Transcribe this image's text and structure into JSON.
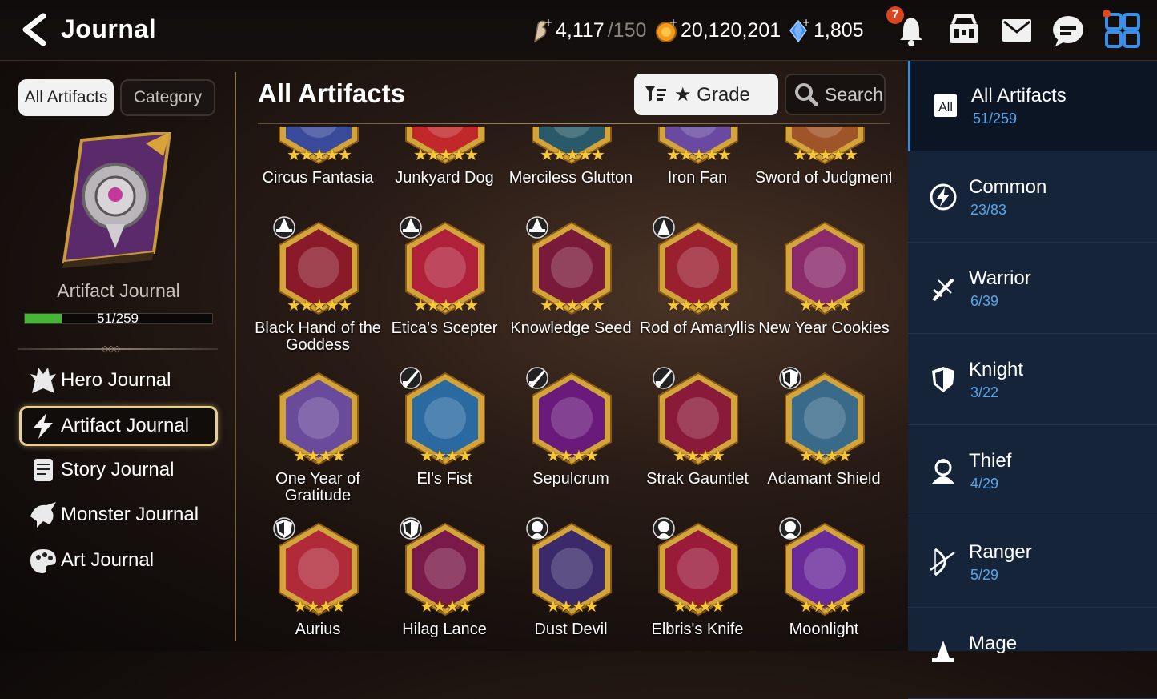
{
  "header": {
    "title": "Journal",
    "stamina_value": "4,117",
    "stamina_max": "/150",
    "gold": "20,120,201",
    "crystals": "1,805",
    "notification_count": "7"
  },
  "left": {
    "tab_all": "All Artifacts",
    "tab_category": "Category",
    "journal_label": "Artifact Journal",
    "progress_text": "51/259",
    "progress_fraction": 0.197,
    "nav": [
      {
        "label": "Hero Journal",
        "icon": "hero-icon"
      },
      {
        "label": "Artifact Journal",
        "icon": "lightning-icon"
      },
      {
        "label": "Story Journal",
        "icon": "scroll-icon"
      },
      {
        "label": "Monster Journal",
        "icon": "monster-icon"
      },
      {
        "label": "Art Journal",
        "icon": "palette-icon"
      }
    ]
  },
  "main": {
    "title": "All Artifacts",
    "grade_label": "★ Grade",
    "search_label": "Search",
    "artifacts": [
      {
        "name": "Circus Fantasia",
        "stars": 5,
        "color": "#3a4a9a",
        "cls": ""
      },
      {
        "name": "Junkyard Dog",
        "stars": 5,
        "color": "#c0282a",
        "cls": ""
      },
      {
        "name": "Merciless Glutton",
        "stars": 5,
        "color": "#2a5a6a",
        "cls": ""
      },
      {
        "name": "Iron Fan",
        "stars": 5,
        "color": "#6a4aa0",
        "cls": ""
      },
      {
        "name": "Sword of Judgment",
        "stars": 5,
        "color": "#a0542a",
        "cls": ""
      },
      {
        "name": "Black Hand of the Goddess",
        "stars": 5,
        "color": "#8a1a2a",
        "cls": "mage"
      },
      {
        "name": "Etica's Scepter",
        "stars": 5,
        "color": "#b0203a",
        "cls": "mage"
      },
      {
        "name": "Knowledge Seed",
        "stars": 5,
        "color": "#7a1a3a",
        "cls": "mage"
      },
      {
        "name": "Rod of Amaryllis",
        "stars": 5,
        "color": "#9a2030",
        "cls": "soul"
      },
      {
        "name": "New Year Cookies",
        "stars": 4,
        "color": "#8a2a6a",
        "cls": ""
      },
      {
        "name": "One Year of Gratitude",
        "stars": 4,
        "color": "#6a4a9a",
        "cls": ""
      },
      {
        "name": "El's Fist",
        "stars": 4,
        "color": "#2a6aa0",
        "cls": "warrior"
      },
      {
        "name": "Sepulcrum",
        "stars": 4,
        "color": "#6a1a7a",
        "cls": "warrior"
      },
      {
        "name": "Strak Gauntlet",
        "stars": 4,
        "color": "#8a1a3a",
        "cls": "warrior"
      },
      {
        "name": "Adamant Shield",
        "stars": 4,
        "color": "#3a6a8a",
        "cls": "knight"
      },
      {
        "name": "Aurius",
        "stars": 4,
        "color": "#b02a3a",
        "cls": "knight"
      },
      {
        "name": "Hilag Lance",
        "stars": 4,
        "color": "#7a1a4a",
        "cls": "knight"
      },
      {
        "name": "Dust Devil",
        "stars": 4,
        "color": "#3a2a6a",
        "cls": "thief"
      },
      {
        "name": "Elbris's Knife",
        "stars": 4,
        "color": "#9a1a3a",
        "cls": "thief"
      },
      {
        "name": "Moonlight",
        "stars": 4,
        "color": "#6a2a9a",
        "cls": "thief"
      }
    ]
  },
  "right": {
    "items": [
      {
        "label": "All Artifacts",
        "count": "51/259",
        "icon": "all-icon",
        "all_text": "All"
      },
      {
        "label": "Common",
        "count": "23/83",
        "icon": "common-icon"
      },
      {
        "label": "Warrior",
        "count": "6/39",
        "icon": "warrior-icon"
      },
      {
        "label": "Knight",
        "count": "3/22",
        "icon": "knight-icon"
      },
      {
        "label": "Thief",
        "count": "4/29",
        "icon": "thief-icon"
      },
      {
        "label": "Ranger",
        "count": "5/29",
        "icon": "ranger-icon"
      },
      {
        "label": "Mage",
        "count": "",
        "icon": "mage-icon"
      }
    ]
  }
}
